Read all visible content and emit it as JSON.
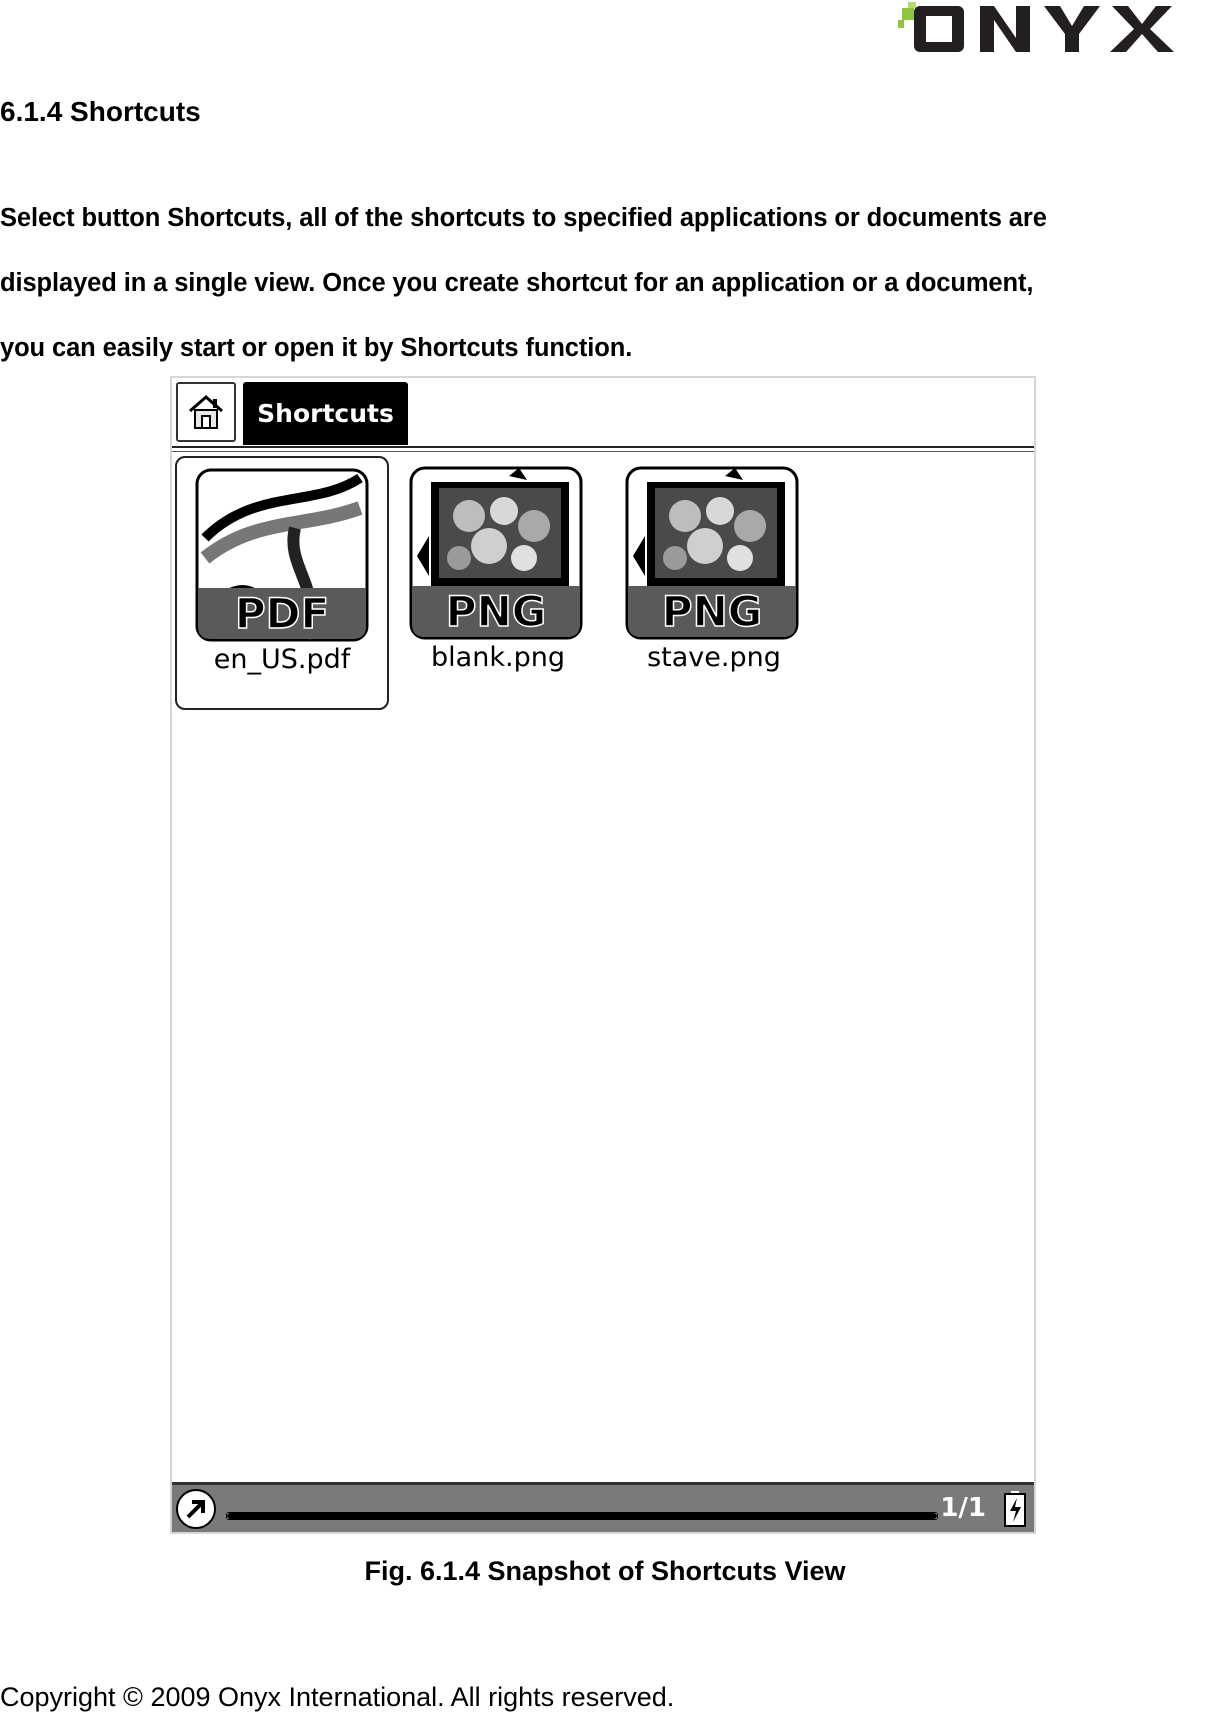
{
  "header": {
    "logo_text": "ONYX"
  },
  "section": {
    "title": "6.1.4 Shortcuts",
    "paragraph_lines": [
      "Select button Shortcuts, all of the shortcuts to specified applications or documents are",
      "displayed in a single view. Once you create shortcut for an application or a document,",
      "you can easily start or open it by Shortcuts function."
    ]
  },
  "device": {
    "home_icon": "home-icon",
    "tab_label": "Shortcuts",
    "items": [
      {
        "icon": "pdf-file-icon",
        "badge": "PDF",
        "label": "en_US.pdf",
        "selected": true
      },
      {
        "icon": "png-file-icon",
        "badge": "PNG",
        "label": "blank.png",
        "selected": false
      },
      {
        "icon": "png-file-icon",
        "badge": "PNG",
        "label": "stave.png",
        "selected": false
      }
    ],
    "status_bar": {
      "back_icon": "back-arrow-icon",
      "progress": 1.0,
      "page": "1/1",
      "battery_icon": "battery-charging-icon"
    }
  },
  "caption": "Fig. 6.1.4 Snapshot of Shortcuts View",
  "footer": "Copyright © 2009 Onyx International. All rights reserved.",
  "colors": {
    "logo_green": "#8cc63f",
    "logo_dark": "#231f20",
    "tab_bg": "#000000",
    "status_bar": "#7a7a7a"
  }
}
